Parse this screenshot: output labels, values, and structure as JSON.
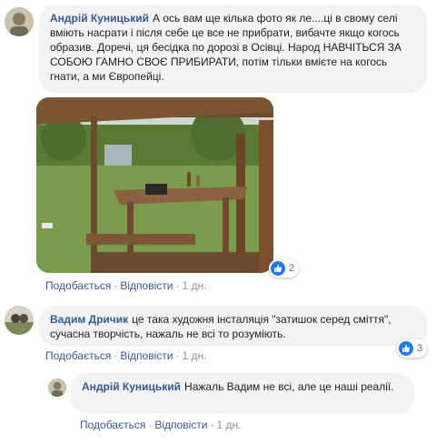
{
  "comments": [
    {
      "author": "Андрій Куницький",
      "text": "А ось вам ще кілька фото як ле....ці в свому селі вміють насрати і після себе це все не прибрати, вибачте якщо когось образив. Доречі, ця бесідка по дорозі в Осівці. Народ НАВЧІТЬСЯ ЗА СОБОЮ ГАМНО СВОЄ ПРИБИРАТИ, потім тільки вмієте на когось гнати, а ми Європейці.",
      "like_label": "Подобається",
      "reply_label": "Відповісти",
      "time": "1 дн.",
      "reaction_count": "2"
    },
    {
      "author": "Вадим Дричик",
      "text": "це така художня інсталяція \"затишок серед сміття\", сучасна творчість, нажаль не всі то розуміють.",
      "like_label": "Подобається",
      "reply_label": "Відповісти",
      "time": "1 дн.",
      "reaction_count": "3"
    },
    {
      "author": "Андрій Куницький",
      "text": "Нажаль Вадим не всі, але це наші реалії.",
      "like_label": "Подобається",
      "reply_label": "Відповісти",
      "time": "1 дн."
    }
  ],
  "separator": "·",
  "colors": {
    "link": "#385898",
    "bubble": "#f2f3f5",
    "meta": "#90949c",
    "like_badge": "#2078f4"
  },
  "icons": {
    "reaction": "thumbs-up-icon"
  }
}
